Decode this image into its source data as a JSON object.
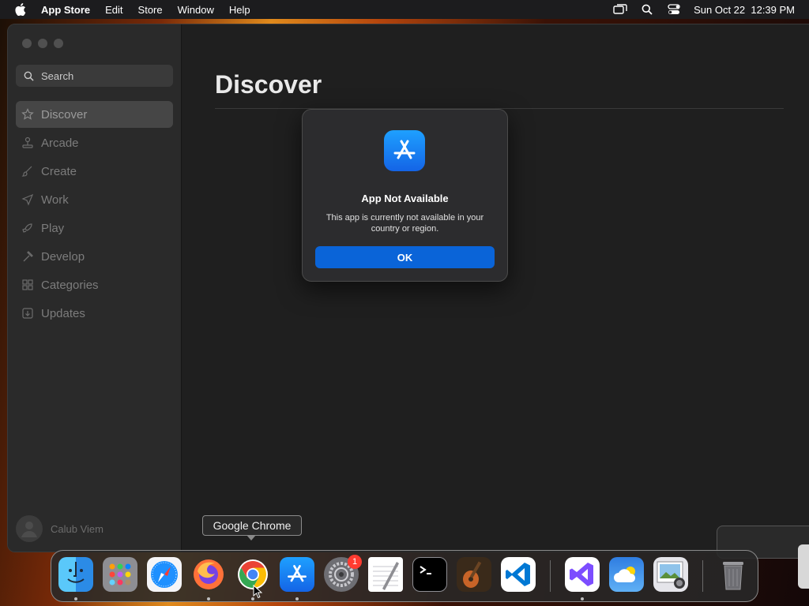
{
  "menubar": {
    "app_name": "App Store",
    "items": [
      "Edit",
      "Store",
      "Window",
      "Help"
    ],
    "datetime": "Sun Oct 22  12:39 PM"
  },
  "sidebar": {
    "search_placeholder": "Search",
    "items": [
      {
        "label": "Discover",
        "icon": "star-icon",
        "active": true
      },
      {
        "label": "Arcade",
        "icon": "joystick-icon"
      },
      {
        "label": "Create",
        "icon": "brush-icon"
      },
      {
        "label": "Work",
        "icon": "paperplane-icon"
      },
      {
        "label": "Play",
        "icon": "rocket-icon"
      },
      {
        "label": "Develop",
        "icon": "hammer-icon"
      },
      {
        "label": "Categories",
        "icon": "grid-icon"
      },
      {
        "label": "Updates",
        "icon": "download-icon"
      }
    ],
    "account_name": "Calub Viem"
  },
  "main": {
    "title": "Discover"
  },
  "dialog": {
    "title": "App Not Available",
    "message": "This app is currently not available in your country or region.",
    "ok_label": "OK"
  },
  "tooltip": {
    "label": "Google Chrome"
  },
  "dock": {
    "badge": "1",
    "apps": [
      "Finder",
      "Launchpad",
      "Safari",
      "Firefox",
      "Google Chrome",
      "App Store",
      "System Settings",
      "TextEdit",
      "Terminal",
      "GarageBand",
      "Visual Studio Code",
      "Visual Studio",
      "Weather",
      "Preview",
      "Trash"
    ]
  }
}
